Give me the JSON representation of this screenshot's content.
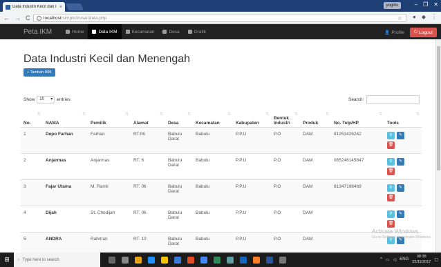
{
  "browser": {
    "tab_title": "Data Industri Kecil dan I",
    "tab_close": "×",
    "url_host": "localhost",
    "url_path": "/simpis3/user/data.php",
    "window_user": "yogiris",
    "window_controls": [
      "–",
      "❐",
      "✕"
    ]
  },
  "navbar": {
    "brand": "Peta IKM",
    "items": [
      {
        "label": "Home"
      },
      {
        "label": "Data IKM"
      },
      {
        "label": "Kecamatan"
      },
      {
        "label": "Desa"
      },
      {
        "label": "Grafik"
      }
    ],
    "profile_label": "Profile",
    "logout_label": "Logout"
  },
  "page": {
    "title": "Data Industri Kecil dan Menengah",
    "add_button": "+ Tambah IKM",
    "show_label": "Show",
    "show_value": "10",
    "entries_label": "entries",
    "search_label": "Search:"
  },
  "table": {
    "columns": [
      "No.",
      "NAMA",
      "Pemilik",
      "Alamat",
      "Desa",
      "Kecamatan",
      "Kabupaten",
      "Bentuk Industri",
      "Produk",
      "No. Telp/HP",
      "Tools"
    ],
    "rows": [
      {
        "no": "1",
        "nama": "Depo Farhan",
        "pemilik": "Farhan",
        "alamat": "RT.06",
        "desa": "Babulu Darat",
        "kecamatan": "Babulu",
        "kabupaten": "P.P.U",
        "bentuk": "P.O",
        "produk": "DAM",
        "telp": "81253426242"
      },
      {
        "no": "2",
        "nama": "Anjarmas",
        "pemilik": "Anjarmas",
        "alamat": "RT. 6",
        "desa": "Babulu Darat",
        "kecamatan": "Babulu",
        "kabupaten": "P.P.U",
        "bentuk": "P.O",
        "produk": "DAM",
        "telp": "085246145847"
      },
      {
        "no": "3",
        "nama": "Fajar Utama",
        "pemilik": "M. Ramli",
        "alamat": "RT. 06",
        "desa": "Babulu Darat",
        "kecamatan": "Babulu",
        "kabupaten": "P.P.U",
        "bentuk": "P.O",
        "produk": "DAM",
        "telp": "81347198469"
      },
      {
        "no": "4",
        "nama": "Dijah",
        "pemilik": "St. Chodijah",
        "alamat": "RT. 06",
        "desa": "Babulu Darat",
        "kecamatan": "Babulu",
        "kabupaten": "P.P.U",
        "bentuk": "P.O",
        "produk": "DAM",
        "telp": ""
      },
      {
        "no": "5",
        "nama": "ANDRA",
        "pemilik": "Rahman",
        "alamat": "RT. 10",
        "desa": "Babulu Darat",
        "kecamatan": "Babulu",
        "kabupaten": "P.P.U",
        "bentuk": "P.O",
        "produk": "DAM",
        "telp": ""
      }
    ]
  },
  "watermark": {
    "title": "Activate Windows",
    "subtitle": "Go to Settings to activate Windows."
  },
  "taskbar": {
    "search_placeholder": "Type here to search",
    "tray_lang": "ENG",
    "time": "08:38",
    "date": "22/11/2017"
  },
  "colors": {
    "navbar": "#222222",
    "primary": "#337ab7",
    "danger": "#d9534f",
    "info": "#5bc0de"
  }
}
